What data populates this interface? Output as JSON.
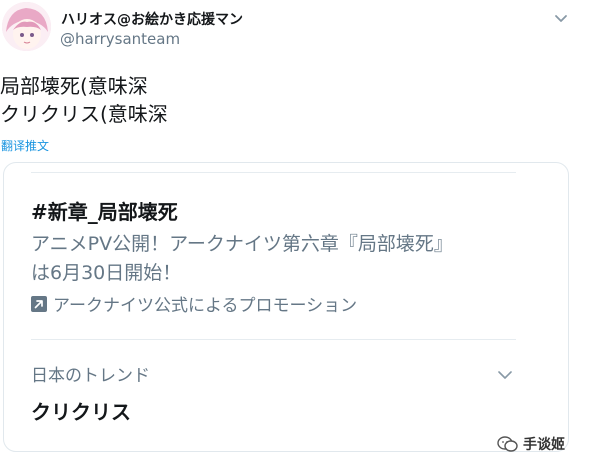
{
  "author": {
    "name": "ハリオス@お絵かき応援マン",
    "handle": "@harrysanteam"
  },
  "tweet": {
    "lines": [
      "局部壊死(意味深",
      "クリクリス(意味深"
    ],
    "translate_label": "翻译推文"
  },
  "card": {
    "trend_title": "#新章_局部壊死",
    "description": "アニメPV公開！アークナイツ第六章『局部壊死』は6月30日開始！",
    "promo_label": "アークナイツ公式によるプロモーション",
    "trends_section_label": "日本のトレンド",
    "trend_name": "クリクリス"
  },
  "watermark": {
    "label": "手谈姬"
  },
  "icons": {
    "caret": "chevron-down-icon",
    "promo": "promoted-arrow-icon",
    "trend_more": "chevron-down-icon",
    "watermark": "wechat-icon"
  },
  "colors": {
    "link": "#1b95e0",
    "secondary_text": "#657786",
    "primary_text": "#14171a",
    "border": "#e1e8ed"
  }
}
